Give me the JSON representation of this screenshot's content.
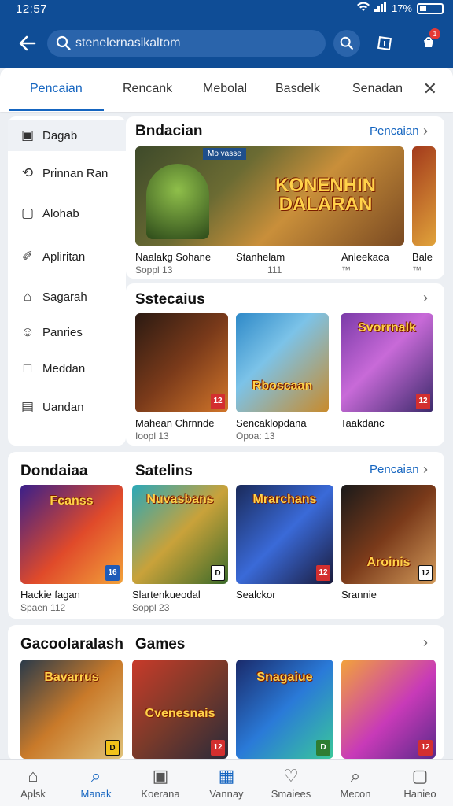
{
  "status": {
    "time": "12:57",
    "signal": "■",
    "battery_text": "17%"
  },
  "header": {
    "search_value": "stenelernasikaltom",
    "cart_badge": "1"
  },
  "tabs": [
    "Pencaian",
    "Rencank",
    "Mebolal",
    "Basdelk",
    "Senadan"
  ],
  "sidebar": [
    {
      "label": "Dagab",
      "icon": "▣"
    },
    {
      "label": "Prinnan Ran",
      "icon": "⟲"
    },
    {
      "label": "Alohab",
      "icon": "▢"
    },
    {
      "label": "Apliritan",
      "icon": "✐"
    },
    {
      "label": "Sagarah",
      "icon": "⌂"
    },
    {
      "label": "Panries",
      "icon": "☺"
    },
    {
      "label": "Meddan",
      "icon": "□"
    },
    {
      "label": "Uandan",
      "icon": "▤"
    }
  ],
  "card1": {
    "title": "Bndacian",
    "link": "Pencaian",
    "banner_tag": "Mo vasse",
    "banner_logo": "KONENHIN DALARAN",
    "items": [
      {
        "name": "Naalakg Sohane",
        "sub": "Soppl 13"
      },
      {
        "name": "Stanhelam",
        "sub": "111"
      },
      {
        "name": "Anleekaca",
        "sub": "™"
      },
      {
        "name": "Bale",
        "sub": "™"
      }
    ]
  },
  "card2": {
    "title": "Sstecaius",
    "items": [
      {
        "name": "Mahean Chrnnde",
        "sub": "Ioopl 13",
        "age": "12",
        "logo": ""
      },
      {
        "name": "Sencaklopdana",
        "sub": "Opoa: 13",
        "age": "",
        "logo": "Rboscaan"
      },
      {
        "name": "Taakdanc",
        "sub": "",
        "age": "12",
        "logo": "Svorrnalk"
      }
    ]
  },
  "card3": {
    "title_left": "Dondaiaa",
    "title_right": "Satelins",
    "link": "Pencaian",
    "items": [
      {
        "name": "Hackie fagan",
        "sub": "Spaen 112",
        "age": "16",
        "logo": "Fcanss"
      },
      {
        "name": "Slartenkueodal",
        "sub": "Soppl 23",
        "age": "D",
        "logo": "Nuvasbans"
      },
      {
        "name": "Sealckor",
        "sub": "",
        "age": "12",
        "logo": "Mrarchans"
      },
      {
        "name": "Srannie",
        "sub": "",
        "age": "12",
        "logo": "Aroinis"
      }
    ]
  },
  "card4": {
    "title_left": "Gacoolaralash",
    "title_right": "Games",
    "items": [
      {
        "age": "D",
        "logo": "Bavarrus"
      },
      {
        "age": "12",
        "logo": "Cvenesnais"
      },
      {
        "age": "D",
        "logo": "Snagaiue"
      },
      {
        "age": "12",
        "logo": ""
      }
    ]
  },
  "bottom_nav": [
    {
      "label": "Aplsk",
      "icon": "⌂"
    },
    {
      "label": "Manak",
      "icon": "⌕"
    },
    {
      "label": "Koerana",
      "icon": "▣"
    },
    {
      "label": "Vannay",
      "icon": "▦"
    },
    {
      "label": "Smaiees",
      "icon": "♡"
    },
    {
      "label": "Mecon",
      "icon": "⌕"
    },
    {
      "label": "Hanieo",
      "icon": "▢"
    }
  ]
}
